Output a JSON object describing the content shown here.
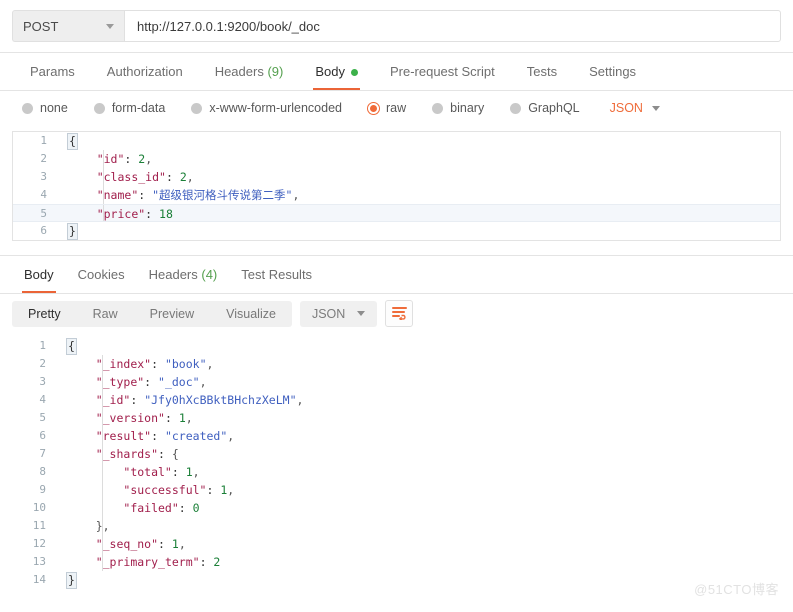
{
  "request": {
    "method": "POST",
    "url": "http://127.0.0.1:9200/book/_doc",
    "tabs": [
      {
        "label": "Params",
        "active": false
      },
      {
        "label": "Authorization",
        "active": false
      },
      {
        "label": "Headers",
        "count": "(9)",
        "active": false
      },
      {
        "label": "Body",
        "active": true
      },
      {
        "label": "Pre-request Script",
        "active": false
      },
      {
        "label": "Tests",
        "active": false
      },
      {
        "label": "Settings",
        "active": false
      }
    ],
    "body_types": [
      {
        "label": "none",
        "selected": false
      },
      {
        "label": "form-data",
        "selected": false
      },
      {
        "label": "x-www-form-urlencoded",
        "selected": false
      },
      {
        "label": "raw",
        "selected": true
      },
      {
        "label": "binary",
        "selected": false
      },
      {
        "label": "GraphQL",
        "selected": false
      }
    ],
    "raw_format": "JSON",
    "body_lines": [
      {
        "n": "1",
        "text": "{",
        "brace": true
      },
      {
        "n": "2",
        "text": "    \"id\": 2,"
      },
      {
        "n": "3",
        "text": "    \"class_id\": 2,"
      },
      {
        "n": "4",
        "text": "    \"name\": \"超级银河格斗传说第二季\","
      },
      {
        "n": "5",
        "text": "    \"price\": 18",
        "highlight": true
      },
      {
        "n": "6",
        "text": "}",
        "brace": true
      }
    ]
  },
  "response": {
    "tabs": [
      {
        "label": "Body",
        "active": true
      },
      {
        "label": "Cookies",
        "active": false
      },
      {
        "label": "Headers",
        "count": "(4)",
        "active": false
      },
      {
        "label": "Test Results",
        "active": false
      }
    ],
    "view_modes": [
      {
        "label": "Pretty",
        "active": true
      },
      {
        "label": "Raw",
        "active": false
      },
      {
        "label": "Preview",
        "active": false
      },
      {
        "label": "Visualize",
        "active": false
      }
    ],
    "format": "JSON",
    "body_lines": [
      {
        "n": "1",
        "text": "{",
        "brace": true
      },
      {
        "n": "2",
        "text": "    \"_index\": \"book\","
      },
      {
        "n": "3",
        "text": "    \"_type\": \"_doc\","
      },
      {
        "n": "4",
        "text": "    \"_id\": \"Jfy0hXcBBktBHchzXeLM\","
      },
      {
        "n": "5",
        "text": "    \"_version\": 1,"
      },
      {
        "n": "6",
        "text": "    \"result\": \"created\","
      },
      {
        "n": "7",
        "text": "    \"_shards\": {"
      },
      {
        "n": "8",
        "text": "        \"total\": 1,"
      },
      {
        "n": "9",
        "text": "        \"successful\": 1,"
      },
      {
        "n": "10",
        "text": "        \"failed\": 0"
      },
      {
        "n": "11",
        "text": "    },"
      },
      {
        "n": "12",
        "text": "    \"_seq_no\": 1,"
      },
      {
        "n": "13",
        "text": "    \"_primary_term\": 2"
      },
      {
        "n": "14",
        "text": "}",
        "brace": true
      }
    ]
  },
  "watermark": "@51CTO博客",
  "colors": {
    "accent": "#eb6437",
    "green": "#3cb14a",
    "count_green": "#55a04f"
  }
}
